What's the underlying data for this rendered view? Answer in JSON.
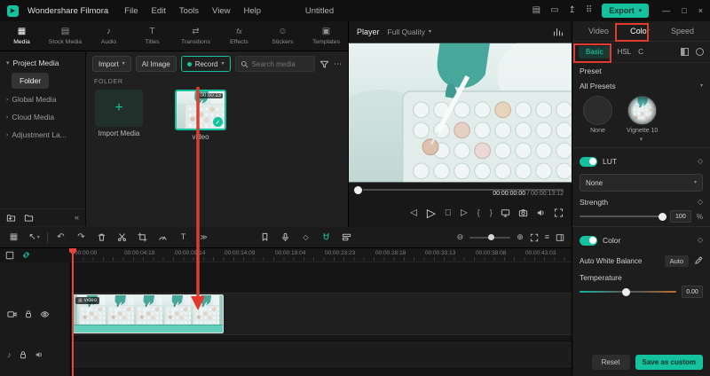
{
  "accent_color": "#14c2a0",
  "annotation_color": "#e23b2e",
  "titlebar": {
    "app_name": "Wondershare Filmora",
    "menus": [
      "File",
      "Edit",
      "Tools",
      "View",
      "Help"
    ],
    "document_title": "Untitled",
    "export_label": "Export"
  },
  "media_panel": {
    "tabs": [
      "Media",
      "Stock Media",
      "Audio",
      "Titles",
      "Transitions",
      "Effects",
      "Stickers",
      "Templates"
    ],
    "sidebar": [
      "Project Media",
      "Folder",
      "Global Media",
      "Cloud Media",
      "Adjustment La..."
    ],
    "toolbar": {
      "import_label": "Import",
      "ai_image_label": "AI Image",
      "record_label": "Record",
      "search_placeholder": "Search media"
    },
    "section_label": "FOLDER",
    "items": [
      {
        "label": "Import Media"
      },
      {
        "label": "video",
        "duration": "00:00:13"
      }
    ]
  },
  "player": {
    "title": "Player",
    "quality": "Full Quality",
    "current_time": "00:00:00:00",
    "separator": " / ",
    "total_time": "00:00:13:12"
  },
  "properties": {
    "tabs": [
      "Video",
      "Color",
      "Speed"
    ],
    "subtabs": [
      "Basic",
      "HSL",
      "C"
    ],
    "preset_label": "Preset",
    "all_presets_label": "All Presets",
    "presets": [
      {
        "label": "None"
      },
      {
        "label": "Vignette 10"
      }
    ],
    "lut_label": "LUT",
    "lut_value": "None",
    "strength_label": "Strength",
    "strength_value": "100",
    "strength_unit": "%",
    "color_label": "Color",
    "awb_label": "Auto White Balance",
    "awb_button": "Auto",
    "temperature_label": "Temperature",
    "temperature_value": "0.00",
    "reset_label": "Reset",
    "save_label": "Save as custom"
  },
  "timeline": {
    "ruler": [
      "00:00:00",
      "00:00:04:19",
      "00:00:09:14",
      "00:00:14:09",
      "00:00:19:04",
      "00:00:23:23",
      "00:00:28:18",
      "00:00:33:13",
      "00:00:38:08",
      "00:00:43:03"
    ],
    "clip_label": "video"
  },
  "icons": {
    "logo_play": "▶",
    "caret": "▾",
    "chevron": "›",
    "collapse": "«",
    "plus": "+",
    "check": "✓",
    "ellipsis": "⋯",
    "more": "≫",
    "undo": "↶",
    "redo": "↷",
    "diamond": "◇",
    "pointer": "↖",
    "menu": "≡",
    "zoom_out": "⊖",
    "zoom_in": "⊕",
    "play": "▷",
    "stop": "□",
    "step_back": "◁",
    "step_fwd": "▷",
    "mark_in": "{",
    "mark_out": "}",
    "note": "♪",
    "win_min": "—",
    "win_max": "□",
    "win_close": "×",
    "tab_media": "▦",
    "tab_stock": "▤",
    "tab_audio": "♪",
    "tab_titles": "T",
    "tab_transitions": "⇄",
    "tab_effects": "fx",
    "tab_stickers": "☺",
    "tab_templates": "▣",
    "tb_layout": "▤",
    "tb_display": "▭",
    "tb_upload": "↥",
    "tb_grid": "⠿",
    "text_tool": "T"
  }
}
